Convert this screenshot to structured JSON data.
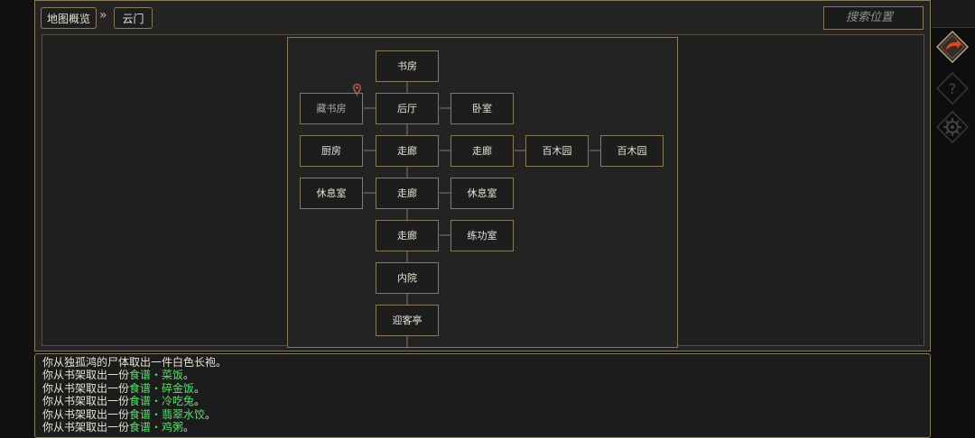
{
  "breadcrumb": {
    "root_label": "地图概览",
    "separator": "»",
    "current_label": "云门"
  },
  "search": {
    "placeholder": "搜索位置"
  },
  "rooms": [
    {
      "id": "shufang",
      "label": "书房"
    },
    {
      "id": "cangshufang",
      "label": "藏书房",
      "current": true
    },
    {
      "id": "houting",
      "label": "后厅"
    },
    {
      "id": "woshi",
      "label": "卧室"
    },
    {
      "id": "chufang",
      "label": "厨房"
    },
    {
      "id": "zoulang1",
      "label": "走廊"
    },
    {
      "id": "zoulang2",
      "label": "走廊"
    },
    {
      "id": "baimuyuan1",
      "label": "百木园"
    },
    {
      "id": "baimuyuan2",
      "label": "百木园"
    },
    {
      "id": "xiuxishi1",
      "label": "休息室"
    },
    {
      "id": "zoulang3",
      "label": "走廊"
    },
    {
      "id": "xiuxishi2",
      "label": "休息室"
    },
    {
      "id": "zoulang4",
      "label": "走廊"
    },
    {
      "id": "liangongshi",
      "label": "练功室"
    },
    {
      "id": "neiyuan",
      "label": "内院"
    },
    {
      "id": "yingketing",
      "label": "迎客亭"
    }
  ],
  "log": [
    {
      "prefix": "你从独孤鸿的尸体取出一件白色长袍。",
      "item": "",
      "suffix": ""
    },
    {
      "prefix": "你从书架取出一份",
      "item": "食谱・菜饭",
      "suffix": "。"
    },
    {
      "prefix": "你从书架取出一份",
      "item": "食谱・碎金饭",
      "suffix": "。"
    },
    {
      "prefix": "你从书架取出一份",
      "item": "食谱・冷吃兔",
      "suffix": "。"
    },
    {
      "prefix": "你从书架取出一份",
      "item": "食谱・翡翠水饺",
      "suffix": "。"
    },
    {
      "prefix": "你从书架取出一份",
      "item": "食谱・鸡粥",
      "suffix": "。"
    }
  ],
  "sidebar": {
    "buttons": [
      "return-icon",
      "help-icon",
      "settings-icon"
    ]
  },
  "colors": {
    "border": "#8a7a5c",
    "highlight": "#58e06a",
    "accent": "#d04a2a",
    "text": "#e8e2d4"
  }
}
